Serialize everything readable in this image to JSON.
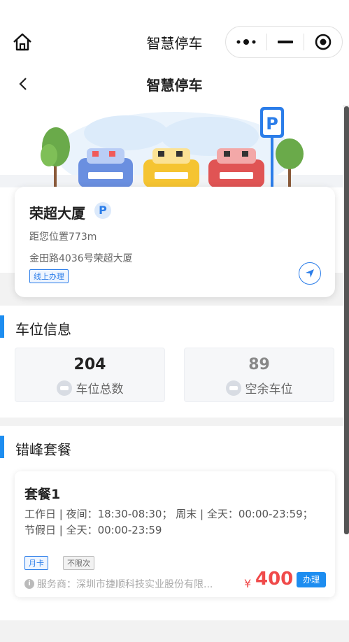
{
  "header": {
    "app_title": "智慧停车",
    "page_title": "智慧停车"
  },
  "parking": {
    "name": "荣超大厦",
    "p_badge": "P",
    "distance": "距您位置773m",
    "address": "金田路4036号荣超大厦",
    "online_tag": "线上办理"
  },
  "space_info": {
    "title": "车位信息",
    "total": "204",
    "total_label": "车位总数",
    "free": "89",
    "free_label": "空余车位"
  },
  "offpeak": {
    "title": "错峰套餐",
    "package": {
      "name": "套餐1",
      "desc": "工作日 | 夜间：18:30-08:30； 周末 | 全天：00:00-23:59； 节假日 | 全天：00:00-23:59",
      "tag_month": "月卡",
      "tag_unlimited": "不限次",
      "provider": "服务商：深圳市捷顺科技实业股份有限...",
      "currency": "¥",
      "price": "400",
      "apply_label": "办理"
    }
  },
  "colors": {
    "accent": "#1d8df0",
    "price": "#f04a4a"
  }
}
